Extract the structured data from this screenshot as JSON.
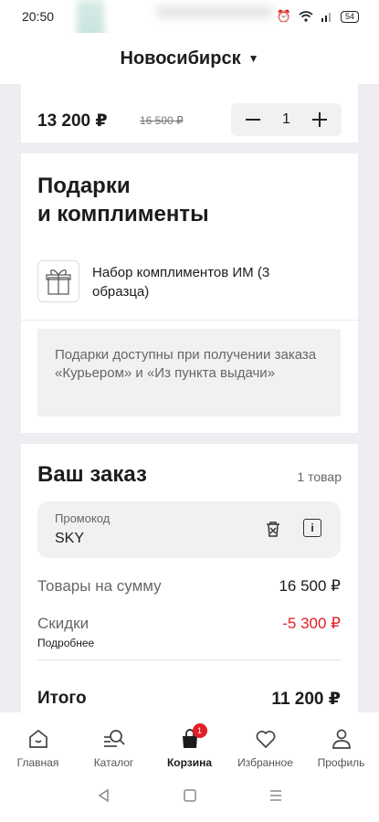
{
  "status": {
    "time": "20:50",
    "battery": "54"
  },
  "city": {
    "name": "Новосибирск"
  },
  "item": {
    "price": "13 200 ₽",
    "old_price": "16 500 ₽",
    "qty": "1",
    "minus": "—",
    "plus": "+"
  },
  "gifts": {
    "title_line1": "Подарки",
    "title_line2": "и комплименты",
    "gift_name": "Набор комплиментов ИМ (3 образца)",
    "note": "Подарки доступны при получении заказа «Курьером» и «Из пункта выдачи»"
  },
  "order": {
    "title": "Ваш заказ",
    "count": "1 товар",
    "promo_label": "Промокод",
    "promo_value": "SKY",
    "info_icon_text": "i",
    "sum_label": "Товары на сумму",
    "sum_value": "16 500 ₽",
    "discount_label": "Скидки",
    "discount_value": "-5 300 ₽",
    "discount_more": "Подробнее",
    "total_label": "Итого",
    "total_value": "11 200 ₽"
  },
  "tabs": [
    {
      "label": "Главная",
      "icon": "home-icon"
    },
    {
      "label": "Каталог",
      "icon": "catalog-search-icon"
    },
    {
      "label": "Корзина",
      "icon": "bag-icon",
      "badge": "1",
      "active": true
    },
    {
      "label": "Избранное",
      "icon": "heart-icon"
    },
    {
      "label": "Профиль",
      "icon": "profile-icon"
    }
  ],
  "colors": {
    "accent": "#e31e24",
    "background": "#ededf2",
    "card": "#ffffff"
  }
}
